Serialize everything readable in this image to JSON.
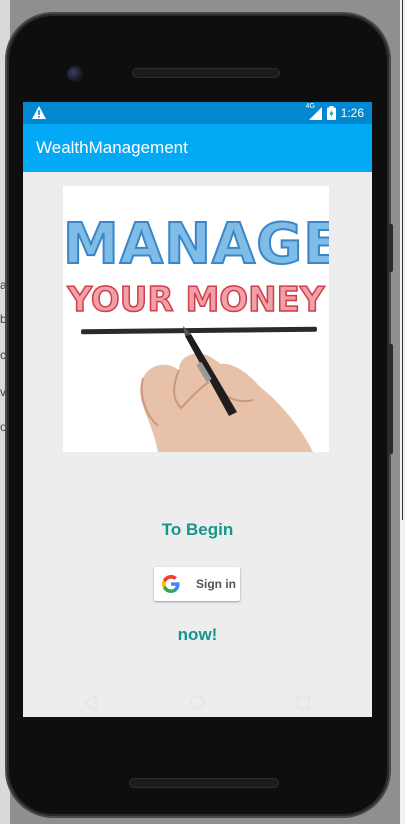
{
  "status_bar": {
    "network": "4G",
    "time": "1:26"
  },
  "app_bar": {
    "title": "WealthManagement"
  },
  "hero_image": {
    "line1": "MANAGE",
    "line2": "YOUR MONEY"
  },
  "main": {
    "to_begin": "To Begin",
    "sign_in_label": "Sign in",
    "now": "now!"
  },
  "background_fragments": [
    "a",
    "b",
    "c",
    "v",
    "o"
  ],
  "colors": {
    "app_bar": "#03a9f4",
    "status_bar": "#0288d1",
    "accent_text": "#14968d",
    "screen_bg": "#ededed"
  },
  "icons": {
    "warning": "warning-icon",
    "battery": "battery-icon",
    "signal": "signal-icon",
    "google": "google-g-icon",
    "back": "back-nav-icon",
    "home": "home-nav-icon",
    "recents": "recents-nav-icon"
  }
}
